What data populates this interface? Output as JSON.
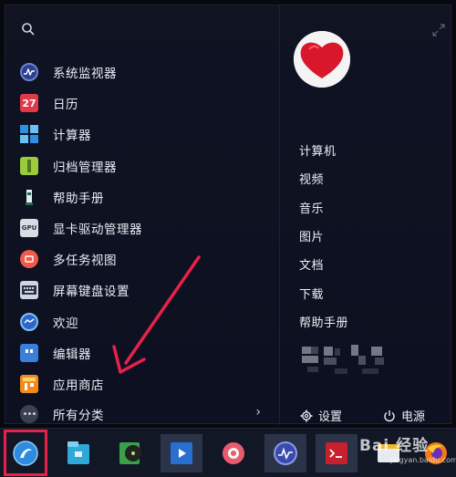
{
  "apps": [
    {
      "label": "系统监视器",
      "icon": "system-monitor-icon",
      "color": "#2b3f8c"
    },
    {
      "label": "日历",
      "icon": "calendar-icon",
      "color": "#e03a4a",
      "badge": "27"
    },
    {
      "label": "计算器",
      "icon": "calculator-icon",
      "color": "#2f8fe0"
    },
    {
      "label": "归档管理器",
      "icon": "archive-manager-icon",
      "color": "#9bcb3c"
    },
    {
      "label": "帮助手册",
      "icon": "help-manual-icon",
      "color": "#1f6b5c"
    },
    {
      "label": "显卡驱动管理器",
      "icon": "gpu-driver-icon",
      "color": "#d8dde2"
    },
    {
      "label": "多任务视图",
      "icon": "multitask-view-icon",
      "color": "#f05a4a"
    },
    {
      "label": "屏幕键盘设置",
      "icon": "keyboard-icon",
      "color": "#cfd6e2"
    },
    {
      "label": "欢迎",
      "icon": "welcome-icon",
      "color": "#2b66c8"
    },
    {
      "label": "编辑器",
      "icon": "editor-icon",
      "color": "#3a7fd9"
    },
    {
      "label": "应用商店",
      "icon": "app-store-icon",
      "color": "#f38a1e"
    }
  ],
  "all_categories": {
    "label": "所有分类",
    "icon": "more-dots-icon"
  },
  "places": [
    "计算机",
    "视频",
    "音乐",
    "图片",
    "文档",
    "下载",
    "帮助手册"
  ],
  "settings_label": "设置",
  "power_label": "电源",
  "taskbar": [
    {
      "name": "launcher-icon",
      "color": "#2d8ce0",
      "highlighted": true
    },
    {
      "name": "file-manager-icon",
      "color": "#2fa8d8"
    },
    {
      "name": "music-player-icon",
      "color": "#3aa14a"
    },
    {
      "name": "video-player-icon",
      "color": "#2a6fd0"
    },
    {
      "name": "control-center-icon",
      "color": "#e85a6e"
    },
    {
      "name": "system-monitor-task-icon",
      "color": "#3a4bb0"
    },
    {
      "name": "terminal-icon",
      "color": "#c8202d"
    },
    {
      "name": "browser-icon",
      "color": "#e7eaef"
    },
    {
      "name": "firefox-icon",
      "color": "#f27a1a"
    }
  ],
  "watermark": {
    "text": "Bai 经验",
    "sub": "jingyan.baidu.com"
  }
}
